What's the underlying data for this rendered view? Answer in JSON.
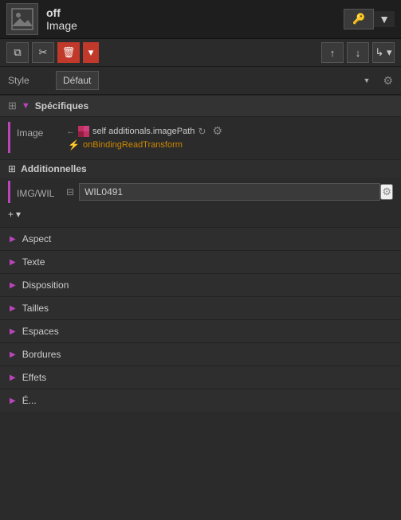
{
  "header": {
    "widget_type": "off",
    "widget_name": "Image",
    "key_button_label": "🔑",
    "dropdown_arrow": "▼"
  },
  "toolbar": {
    "copy_icon": "⧉",
    "cut_icon": "✂",
    "delete_icon": "🗑",
    "dropdown_icon": "▾",
    "up_icon": "↑",
    "down_icon": "↓",
    "indent_icon": "↳"
  },
  "style_row": {
    "label": "Style",
    "value": "Défaut"
  },
  "specifiques": {
    "header_label": "Spécifiques",
    "image_prop": {
      "name": "Image",
      "binding": "self additionals.imagePath",
      "transform": "onBindingReadTransform"
    }
  },
  "additionnelles": {
    "header_label": "Additionnelles",
    "img_wil": {
      "name": "IMG/WIL",
      "value": "WIL0491"
    },
    "add_button": "+ ▾"
  },
  "sections": [
    {
      "label": "Aspect"
    },
    {
      "label": "Texte"
    },
    {
      "label": "Disposition"
    },
    {
      "label": "Tailles"
    },
    {
      "label": "Espaces"
    },
    {
      "label": "Bordures"
    },
    {
      "label": "Effets"
    },
    {
      "label": "É..."
    }
  ]
}
